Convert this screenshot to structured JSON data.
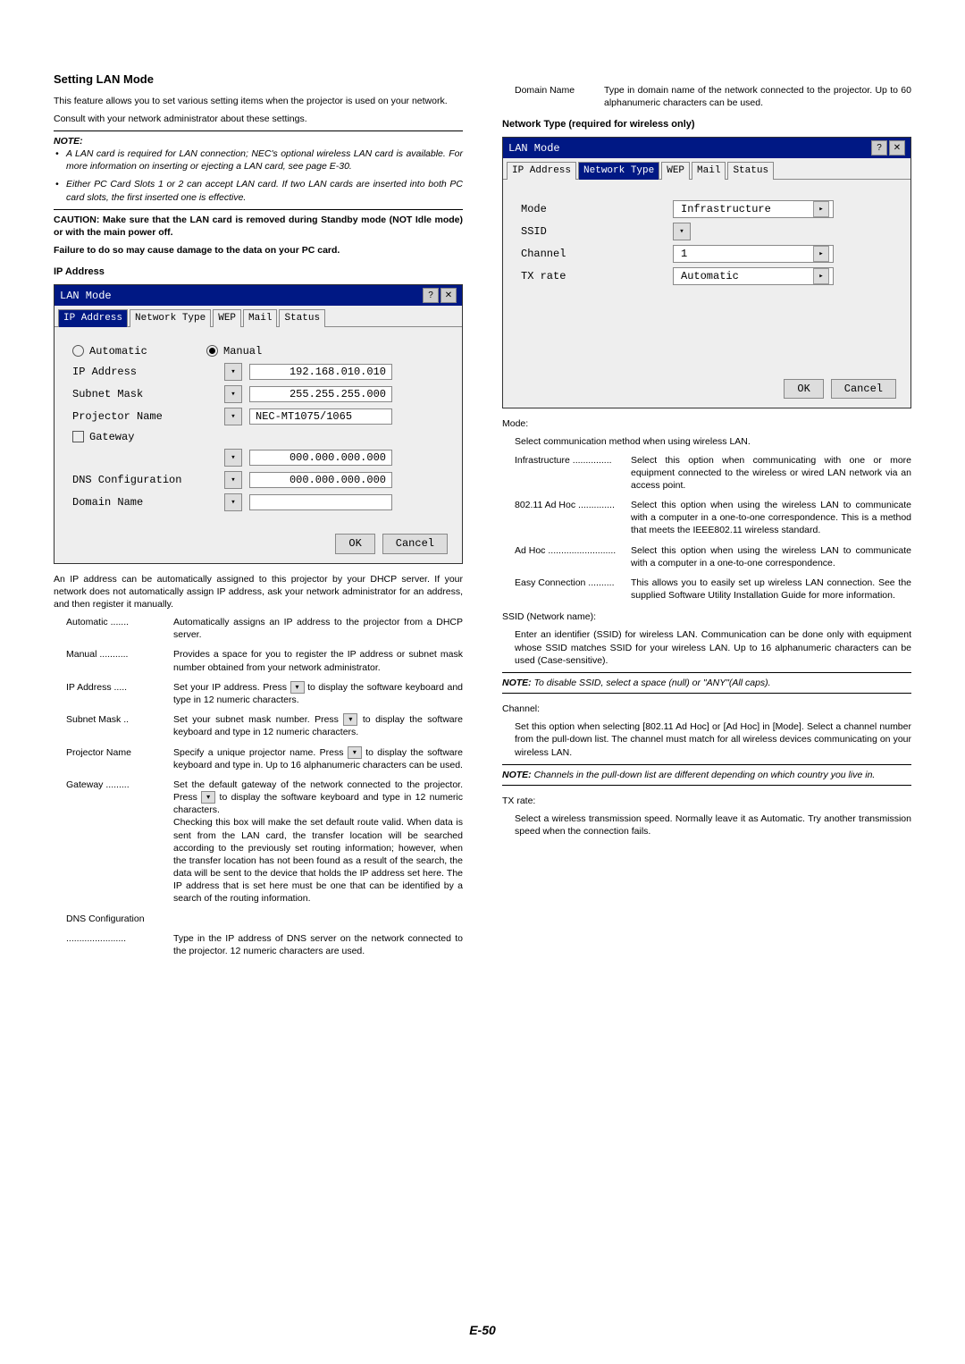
{
  "pagenum": "E-50",
  "left": {
    "h": "Setting LAN Mode",
    "p1": "This feature allows you to set various setting items when the projector is used on your network.",
    "p2": "Consult with your network administrator about these settings.",
    "noteLabel": "NOTE:",
    "li1": "A LAN card is required for LAN connection; NEC's optional wireless LAN card is available. For more information on inserting or ejecting a LAN card, see page E-30.",
    "li2": "Either PC Card Slots 1 or 2 can accept LAN card. If two LAN cards are inserted into both PC card slots, the first inserted one is effective.",
    "caution": "CAUTION: Make sure that the LAN card is removed during Standby mode (NOT Idle mode) or with the main power off.",
    "caution2": "Failure to do so may cause damage to the data on your PC card.",
    "sub1": "IP Address",
    "dlg1": {
      "title": "LAN Mode",
      "tabs": [
        "IP Address",
        "Network Type",
        "WEP",
        "Mail",
        "Status"
      ],
      "autoLabel": "Automatic",
      "manLabel": "Manual",
      "ip_l": "IP Address",
      "ip_v": "192.168.010.010",
      "sm_l": "Subnet Mask",
      "sm_v": "255.255.255.000",
      "pn_l": "Projector Name",
      "pn_v": "NEC-MT1075/1065",
      "gw_l": "Gateway",
      "gw_v": "000.000.000.000",
      "dns_l": "DNS Configuration",
      "dns_v": "000.000.000.000",
      "dn_l": "Domain Name",
      "ok": "OK",
      "cancel": "Cancel"
    },
    "p3": "An IP address can be automatically assigned to this projector by your DHCP server. If your network does not automatically assign IP address, ask your network administrator for an address, and then register it manually.",
    "d1t": "Automatic",
    "d1": "Automatically assigns an IP address to the projector from a DHCP server.",
    "d2t": "Manual",
    "d2": "Provides a space for you to register the IP address or subnet mask number obtained from your network administrator.",
    "d3t": "IP Address",
    "d3a": "Set your IP address. Press",
    "d3b": "to display the software keyboard and type in 12 numeric characters.",
    "d4t": "Subnet Mask",
    "d4a": "Set your subnet mask number. Press",
    "d4b": "to display the software keyboard and type in 12 numeric characters.",
    "d5t": "Projector Name",
    "d5a": "Specify a unique projector name. Press",
    "d5b": "to display the software keyboard and type in. Up to 16 alphanumeric characters can be used.",
    "d6t": "Gateway",
    "d6a": "Set the default gateway of the network connected to the projector. Press",
    "d6b": "to display the software keyboard and type in 12 numeric characters.",
    "d6c": "Checking this box will make the set default route valid. When data is sent from the LAN card, the transfer location will be searched according to the previously set routing information; however, when the transfer location has not been found as a result of the search, the data will be sent to the device that holds the IP address set here. The IP address that is set here must be one that can be identified by a search of the routing information.",
    "d7t": "DNS Configuration",
    "d7": "Type in the IP address of DNS server on the network connected to the projector. 12 numeric characters are used."
  },
  "right": {
    "d8t": "Domain Name",
    "d8": "Type in domain name of the network connected to the projector. Up to 60 alphanumeric characters can be used.",
    "sub2": "Network Type (required for wireless only)",
    "dlg2": {
      "title": "LAN Mode",
      "tabs": [
        "IP Address",
        "Network Type",
        "WEP",
        "Mail",
        "Status"
      ],
      "mode_l": "Mode",
      "mode_v": "Infrastructure",
      "ssid_l": "SSID",
      "ch_l": "Channel",
      "ch_v": "1",
      "tx_l": "TX rate",
      "tx_v": "Automatic",
      "ok": "OK",
      "cancel": "Cancel"
    },
    "mode_h": "Mode:",
    "mode_d": "Select communication method when using wireless LAN.",
    "m1t": "Infrastructure",
    "m1": "Select this option when communicating with one or more equipment connected to the wireless or wired LAN network via an access point.",
    "m2t": "802.11 Ad Hoc",
    "m2": "Select this option when using the wireless LAN to communicate with a computer in a one-to-one correspondence. This is a method that meets the IEEE802.11 wireless standard.",
    "m3t": "Ad Hoc",
    "m3": "Select this option when using the wireless LAN to communicate with a computer in a one-to-one correspondence.",
    "m4t": "Easy Connection",
    "m4": "This allows you to easily set up wireless LAN connection. See the supplied Software Utility Installation Guide for more information.",
    "ssid_h": "SSID (Network name):",
    "ssid_d": "Enter an identifier (SSID) for wireless LAN. Communication can be done only with equipment whose SSID matches SSID for your wireless LAN. Up to 16 alphanumeric characters can be used (Case-sensitive).",
    "ssid_note": "To disable SSID, select a space (null) or \"ANY\"(All caps).",
    "ch_h": "Channel:",
    "ch_d": "Set this option when selecting [802.11 Ad Hoc] or [Ad Hoc] in [Mode]. Select a channel number from the pull-down list. The channel must match for all wireless devices communicating on your wireless LAN.",
    "ch_note": "Channels in the pull-down list are different depending on which country you live in.",
    "tx_h": "TX rate:",
    "tx_d": "Select a wireless transmission speed. Normally leave it as Automatic. Try another transmission speed when the connection fails.",
    "notew": "NOTE:"
  }
}
